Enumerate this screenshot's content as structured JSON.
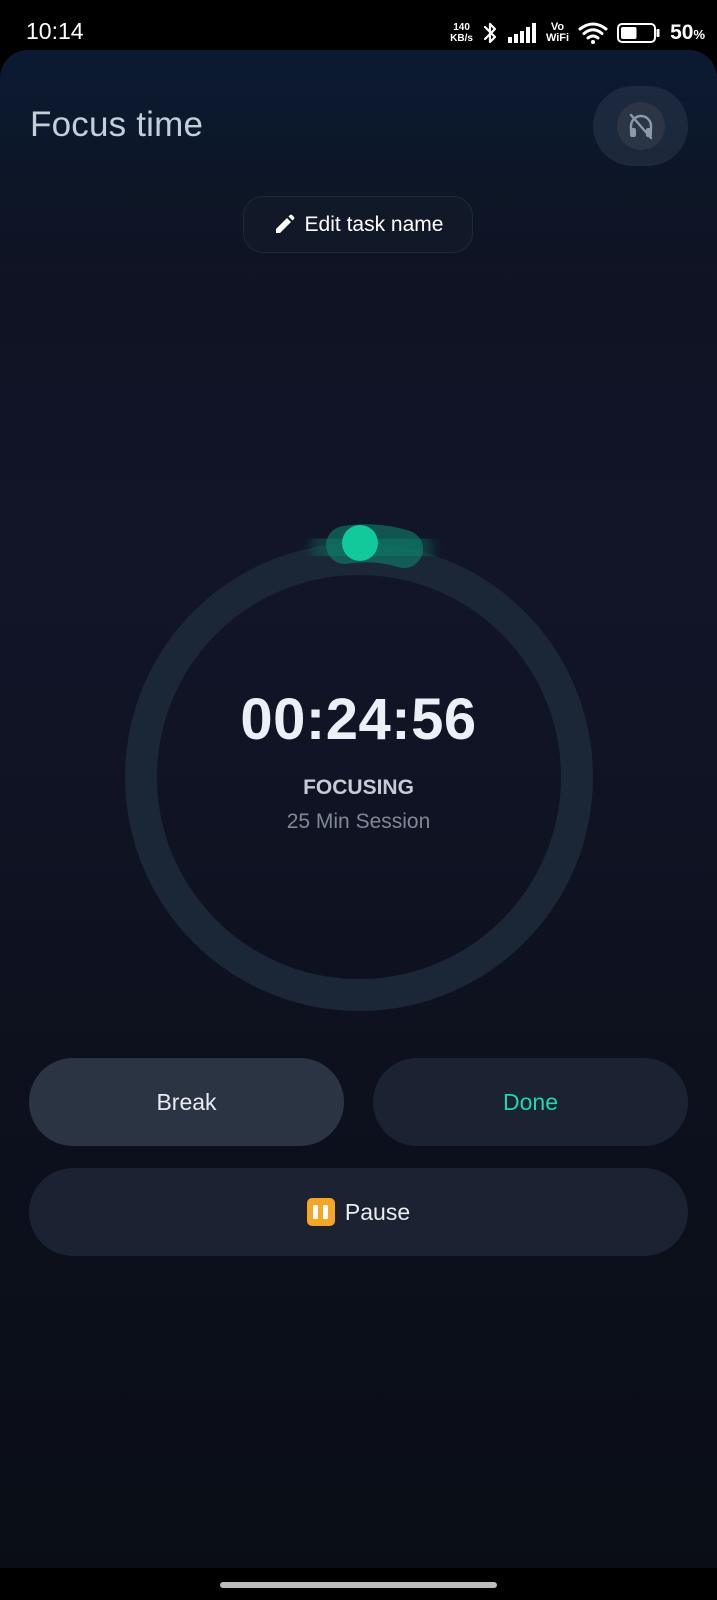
{
  "status_bar": {
    "time": "10:14",
    "net_speed_value": "140",
    "net_speed_unit": "KB/s",
    "vo_top": "Vo",
    "vo_bottom": "WiFi",
    "battery_percent": "50",
    "battery_percent_sign": "%",
    "battery_level": 0.5
  },
  "header": {
    "title": "Focus time",
    "headset_icon": "headphones-off-icon"
  },
  "task": {
    "edit_label": "Edit task name",
    "edit_icon": "pencil-icon"
  },
  "timer": {
    "time": "00:24:56",
    "status": "FOCUSING",
    "session": "25 Min Session",
    "progress_fraction": 0.003,
    "track_color": "#1b2636",
    "accent_color": "#12c99b"
  },
  "buttons": {
    "break_label": "Break",
    "done_label": "Done",
    "pause_label": "Pause",
    "pause_icon": "pause-icon",
    "done_color": "#22d6a8",
    "pause_icon_color": "#f5a623"
  }
}
